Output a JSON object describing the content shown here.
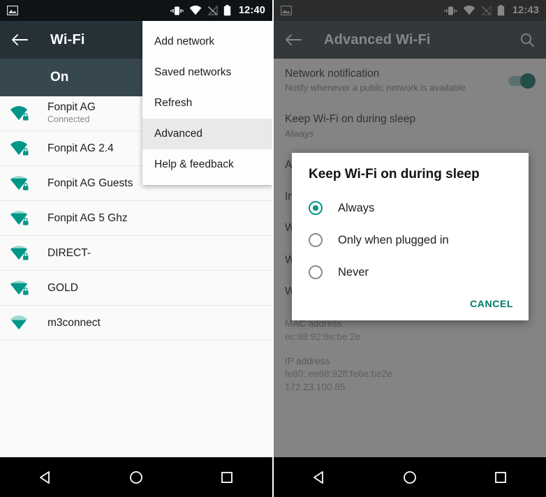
{
  "left_screen": {
    "status_bar": {
      "time": "12:40",
      "icons": [
        "screenshot-icon",
        "vibrate-icon",
        "wifi-icon",
        "signal-off-icon",
        "battery-icon"
      ]
    },
    "toolbar": {
      "title": "Wi-Fi",
      "back_icon": "back-arrow-icon"
    },
    "master_switch_row": {
      "label": "On"
    },
    "networks": [
      {
        "name": "Fonpit AG",
        "status": "Connected",
        "secured": true,
        "bars": 4
      },
      {
        "name": "Fonpit AG 2.4",
        "status": "",
        "secured": true,
        "bars": 4
      },
      {
        "name": "Fonpit AG Guests",
        "status": "",
        "secured": true,
        "bars": 3
      },
      {
        "name": "Fonpit AG 5 Ghz",
        "status": "",
        "secured": true,
        "bars": 3
      },
      {
        "name": "DIRECT-",
        "status": "",
        "secured": true,
        "bars": 3
      },
      {
        "name": "GOLD",
        "status": "",
        "secured": true,
        "bars": 3
      },
      {
        "name": "m3connect",
        "status": "",
        "secured": false,
        "bars": 2
      }
    ],
    "overflow_menu": {
      "items": [
        {
          "label": "Add network",
          "highlighted": false
        },
        {
          "label": "Saved networks",
          "highlighted": false
        },
        {
          "label": "Refresh",
          "highlighted": false
        },
        {
          "label": "Advanced",
          "highlighted": true
        },
        {
          "label": "Help & feedback",
          "highlighted": false
        }
      ]
    },
    "nav_bar": {
      "back": "back-triangle-icon",
      "home": "home-circle-icon",
      "recents": "recents-square-icon"
    }
  },
  "right_screen": {
    "status_bar": {
      "time": "12:43",
      "icons": [
        "screenshot-icon",
        "vibrate-icon",
        "wifi-icon",
        "signal-off-icon",
        "battery-icon"
      ]
    },
    "toolbar": {
      "title": "Advanced Wi-Fi",
      "back_icon": "back-arrow-icon",
      "action_icon": "search-icon"
    },
    "settings": [
      {
        "title": "Network notification",
        "subtitle": "Notify whenever a public network is available",
        "toggle": "on"
      },
      {
        "title": "Keep Wi-Fi on during sleep",
        "subtitle": "Always",
        "toggle": ""
      },
      {
        "title": "Avoid poor connections",
        "subtitle": "",
        "toggle": ""
      },
      {
        "title": "Install certificates",
        "subtitle": "",
        "toggle": ""
      },
      {
        "title": "Wi-Fi Direct",
        "subtitle": "",
        "toggle": ""
      },
      {
        "title": "WPS Push Button",
        "subtitle": "",
        "toggle": ""
      },
      {
        "title": "WPS Pin Entry",
        "subtitle": "",
        "toggle": ""
      }
    ],
    "info": [
      {
        "key": "MAC address",
        "value": "ec:88:92:6e:be:2e"
      },
      {
        "key": "IP address",
        "value": "fe80::ee88:92ff:fe6e:be2e\n172.23.100.85"
      }
    ],
    "dialog": {
      "title": "Keep Wi-Fi on during sleep",
      "options": [
        {
          "label": "Always",
          "selected": true
        },
        {
          "label": "Only when plugged in",
          "selected": false
        },
        {
          "label": "Never",
          "selected": false
        }
      ],
      "cancel_label": "CANCEL"
    },
    "nav_bar": {
      "back": "back-triangle-icon",
      "home": "home-circle-icon",
      "recents": "recents-square-icon"
    }
  },
  "colors": {
    "toolbar": "#263238",
    "master_row": "#37474f",
    "accent": "#009688",
    "cancel": "#00796b"
  }
}
